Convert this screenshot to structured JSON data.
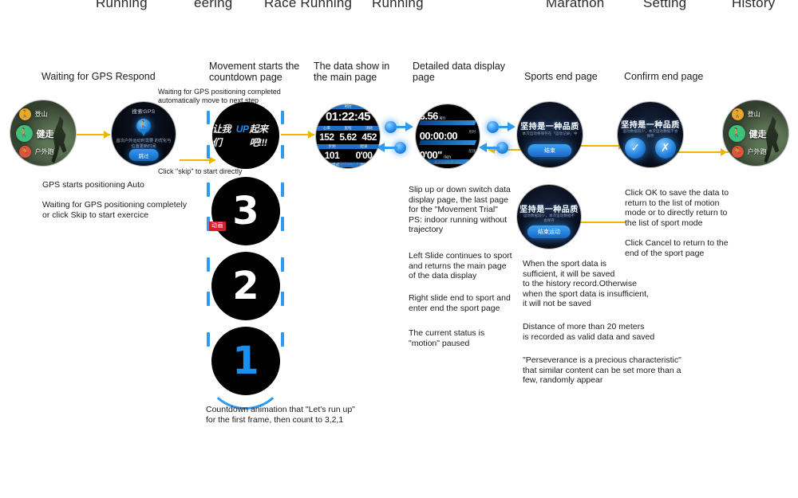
{
  "header": {
    "tabs": [
      {
        "label": "Running"
      },
      {
        "label": "eering"
      },
      {
        "label": "Race Running"
      },
      {
        "label": "Running"
      },
      {
        "label": "Marathon"
      },
      {
        "label": "Setting"
      },
      {
        "label": "History"
      }
    ]
  },
  "stages": [
    {
      "id": "gps-respond",
      "caption": "Waiting for GPS Respond"
    },
    {
      "id": "countdown",
      "caption": "Movement starts the\ncountdown page"
    },
    {
      "id": "main-data",
      "caption": "The data show in\nthe main page"
    },
    {
      "id": "detail-data",
      "caption": "Detailed data display\npage"
    },
    {
      "id": "sports-end",
      "caption": "Sports end page"
    },
    {
      "id": "confirm-end",
      "caption": "Confirm end page"
    }
  ],
  "inline_notes": {
    "gps_complete": "Waiting for GPS positioning completed\nautomatically move to next step",
    "click_skip": "Click \"skip\" to start directly"
  },
  "notes": {
    "gps": "GPS starts positioning Auto\n\nWaiting for GPS positioning completely\nor click Skip to start exercice",
    "countdown": "Countdown animation that \"Let's run up\"\nfor the first frame, then count to 3,2,1",
    "slide_switch": "Slip up or down switch data\ndisplay page, the last page\nfor the \"Movement Trial\"\n PS: indoor running without\ntrajectory",
    "left_slide": "Left Slide continues to sport\nand returns the main page\nof the data display",
    "right_slide": "Right slide end to sport and\nenter end the sport page",
    "current_status": "The current status is\n \"motion\" paused",
    "data_sufficient": "When the sport data is\nsufficient, it will be saved\nto the history record.Otherwise\nwhen the sport data is insufficient,\nit will not be saved",
    "distance_rule": "Distance of more than 20 meters\nis recorded as valid data and saved",
    "perseverance": "\"Perseverance is a precious characteristic\"\nthat similar content can be set more than a\nfew, randomly appear",
    "click_ok": "Click OK to save the data to\nreturn to the list of motion\nmode or to directly return to\nthe list of sport mode",
    "click_cancel": "Click Cancel to return to the\nend of the sport page"
  },
  "watch_modes": {
    "items": [
      {
        "label": "登山",
        "glyph": "Ὣ6",
        "color": "#e8a82b"
      },
      {
        "label": "健走",
        "glyph": "Ὣ6",
        "color": "#3ec17a"
      },
      {
        "label": "户外跑",
        "glyph": "Ἴ3",
        "color": "#e0543a"
      }
    ]
  },
  "watch_gps": {
    "title": "搜索GPS",
    "pin_icon": "location-pin-icon",
    "message": "首次户外运动时需要\n的优化与位置更新时间",
    "button": "跳过"
  },
  "watch_slogan": {
    "prefix": "让我们",
    "accent": "UP",
    "suffix": "起来吧!!!"
  },
  "watch_main_data": {
    "time_header": "用时",
    "time_value": "01:22:45",
    "row1_headers": [
      "心率",
      "里程",
      "消耗"
    ],
    "row1_values": [
      "152",
      "5.62",
      "452"
    ],
    "row2_headers": [
      "步频",
      "配速"
    ],
    "row2_values": [
      "101",
      "0'00"
    ],
    "bottom_headers": [
      "跑步模式",
      "地图"
    ],
    "footer": "自动暂停功能已开启"
  },
  "watch_detail": {
    "rows": [
      {
        "value": "3.56",
        "unit": "km",
        "tag": "里程"
      },
      {
        "value": "00:00:00",
        "unit": "",
        "tag": "用时"
      },
      {
        "value": "0'00\"",
        "unit": "/ km",
        "tag": "配速"
      }
    ],
    "footer": "本次运动轨迹·GPS"
  },
  "watch_end": {
    "title": "坚持是一种品质",
    "subtitle": "本次运动将保存在「运动记录」中",
    "button": "结束"
  },
  "watch_end2": {
    "title": "坚持是一种品质",
    "subtitle": "运动数据较少，本次运动数据不会保存",
    "button": "结束运动"
  },
  "watch_confirm": {
    "title": "坚持是一种品质",
    "subtitle": "运动数据较少，本次运动数据不会保存",
    "ok_icon": "check-icon",
    "cancel_icon": "close-icon"
  },
  "countdown": {
    "frames": [
      "3",
      "2",
      "1"
    ],
    "badge": "动画"
  },
  "colors": {
    "accent_blue": "#2f9bf0",
    "connector_yellow": "#f0b400",
    "badge_red": "#d81e2a"
  }
}
